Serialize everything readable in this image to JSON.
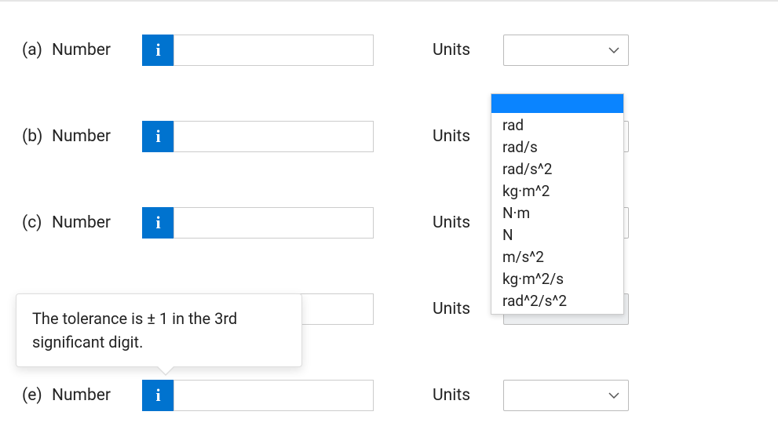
{
  "rows": [
    {
      "part": "(a)",
      "label": "Number",
      "unitsLabel": "Units",
      "value": "",
      "shaded": false
    },
    {
      "part": "(b)",
      "label": "Number",
      "unitsLabel": "Units",
      "value": "",
      "shaded": false
    },
    {
      "part": "(c)",
      "label": "Number",
      "unitsLabel": "Units",
      "value": "",
      "shaded": false
    },
    {
      "part": "",
      "label": "",
      "unitsLabel": "Units",
      "value": "",
      "shaded": true
    },
    {
      "part": "(e)",
      "label": "Number",
      "unitsLabel": "Units",
      "value": "",
      "shaded": false
    }
  ],
  "dropdown": {
    "options": [
      "rad",
      "rad/s",
      "rad/s^2",
      "kg·m^2",
      "N·m",
      "N",
      "m/s^2",
      "kg·m^2/s",
      "rad^2/s^2"
    ]
  },
  "tooltip": {
    "text": "The tolerance is ± 1 in the 3rd significant digit."
  },
  "info_glyph": "i"
}
